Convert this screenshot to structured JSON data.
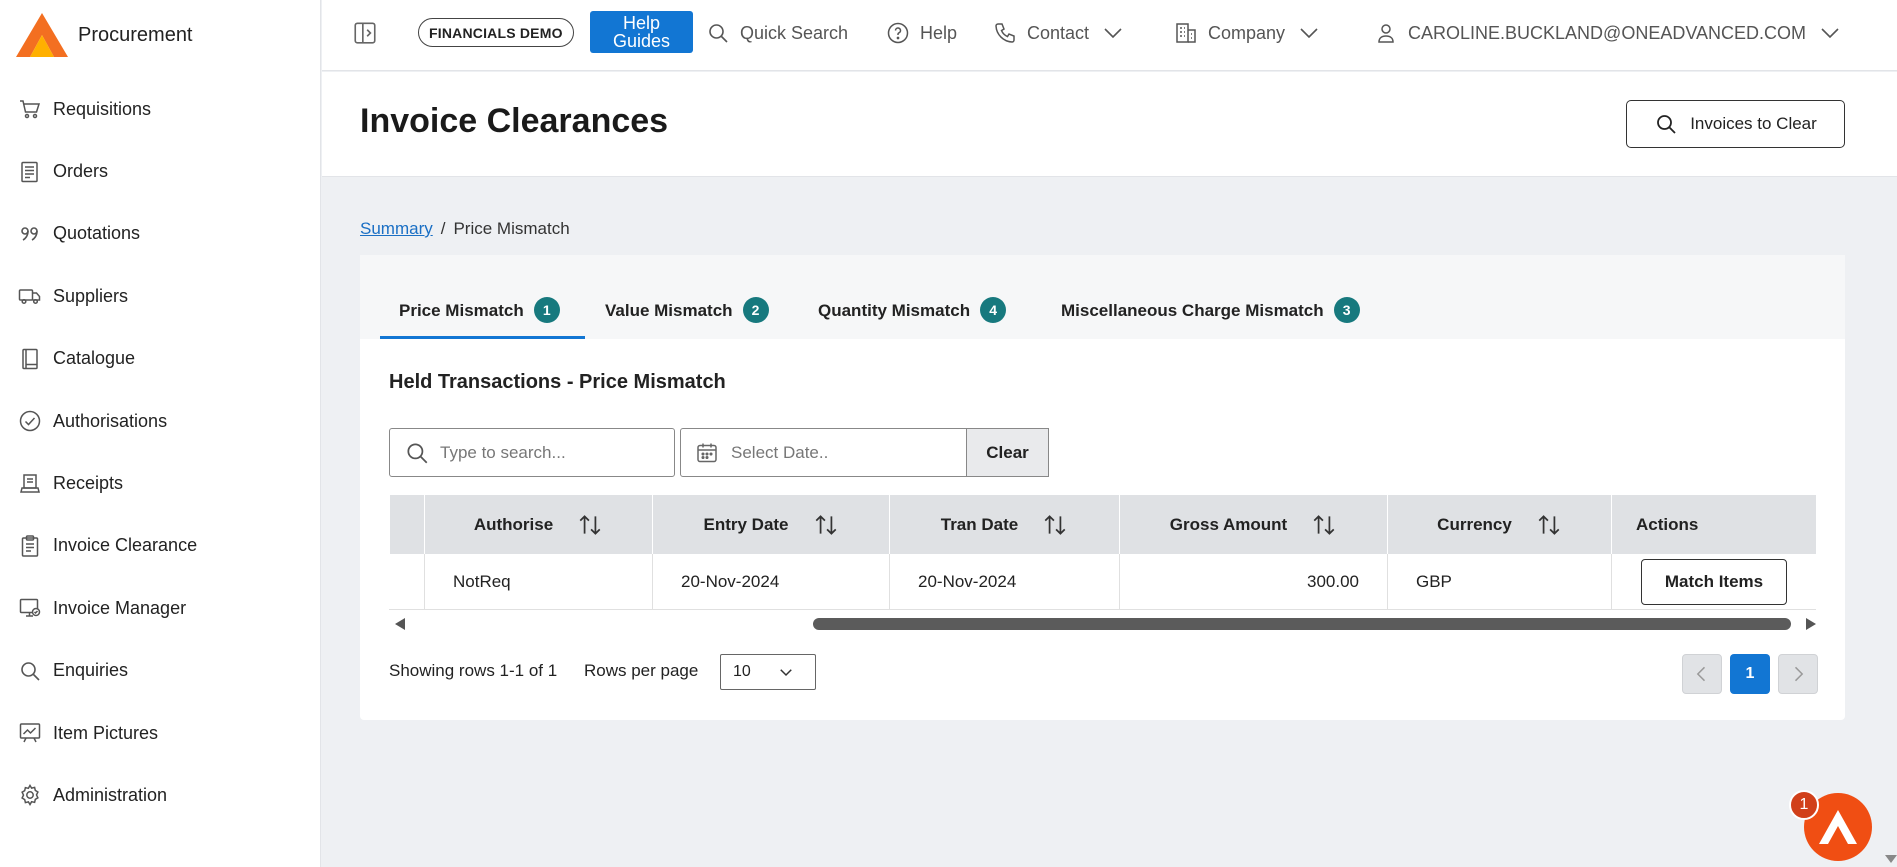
{
  "app": {
    "name": "Procurement",
    "brand_color": "#f36f21"
  },
  "sidebar": {
    "items": [
      {
        "label": "Requisitions",
        "icon": "cart-icon"
      },
      {
        "label": "Orders",
        "icon": "orders-icon"
      },
      {
        "label": "Quotations",
        "icon": "quote-icon"
      },
      {
        "label": "Suppliers",
        "icon": "truck-icon"
      },
      {
        "label": "Catalogue",
        "icon": "book-icon"
      },
      {
        "label": "Authorisations",
        "icon": "check-circle-icon"
      },
      {
        "label": "Receipts",
        "icon": "receipt-icon"
      },
      {
        "label": "Invoice Clearance",
        "icon": "clipboard-icon"
      },
      {
        "label": "Invoice Manager",
        "icon": "invoice-manager-icon"
      },
      {
        "label": "Enquiries",
        "icon": "search-icon"
      },
      {
        "label": "Item Pictures",
        "icon": "chart-board-icon"
      },
      {
        "label": "Administration",
        "icon": "gear-icon"
      }
    ]
  },
  "topbar": {
    "env_badge": "FINANCIALS DEMO",
    "help_guides": "Help Guides",
    "quick_search": "Quick Search",
    "help": "Help",
    "contact": "Contact",
    "company": "Company",
    "user": "CAROLINE.BUCKLAND@ONEADVANCED.COM"
  },
  "page": {
    "title": "Invoice Clearances",
    "invoices_to_clear": "Invoices to Clear"
  },
  "breadcrumb": {
    "root": "Summary",
    "sep": "/",
    "current": "Price Mismatch"
  },
  "tabs": [
    {
      "label": "Price Mismatch",
      "count": "1",
      "active": true
    },
    {
      "label": "Value Mismatch",
      "count": "2",
      "active": false
    },
    {
      "label": "Quantity Mismatch",
      "count": "4",
      "active": false
    },
    {
      "label": "Miscellaneous Charge Mismatch",
      "count": "3",
      "active": false
    }
  ],
  "section": {
    "title": "Held Transactions - Price Mismatch"
  },
  "filters": {
    "search_placeholder": "Type to search...",
    "date_placeholder": "Select Date..",
    "clear_label": "Clear"
  },
  "table": {
    "headers": [
      "Authorise",
      "Entry Date",
      "Tran Date",
      "Gross Amount",
      "Currency",
      "Actions"
    ],
    "rows": [
      {
        "authorise": "NotReq",
        "entry_date": "20-Nov-2024",
        "tran_date": "20-Nov-2024",
        "gross_amount": "300.00",
        "currency": "GBP",
        "action": "Match Items"
      }
    ]
  },
  "pagination": {
    "showing": "Showing rows 1-1 of 1",
    "rows_per_page_label": "Rows per page",
    "rows_per_page": "10",
    "current_page": "1"
  },
  "fab": {
    "notifications": "1"
  },
  "colors": {
    "accent_blue": "#1276d3",
    "tab_count_teal": "#17797e",
    "fab_orange": "#f04e13"
  }
}
